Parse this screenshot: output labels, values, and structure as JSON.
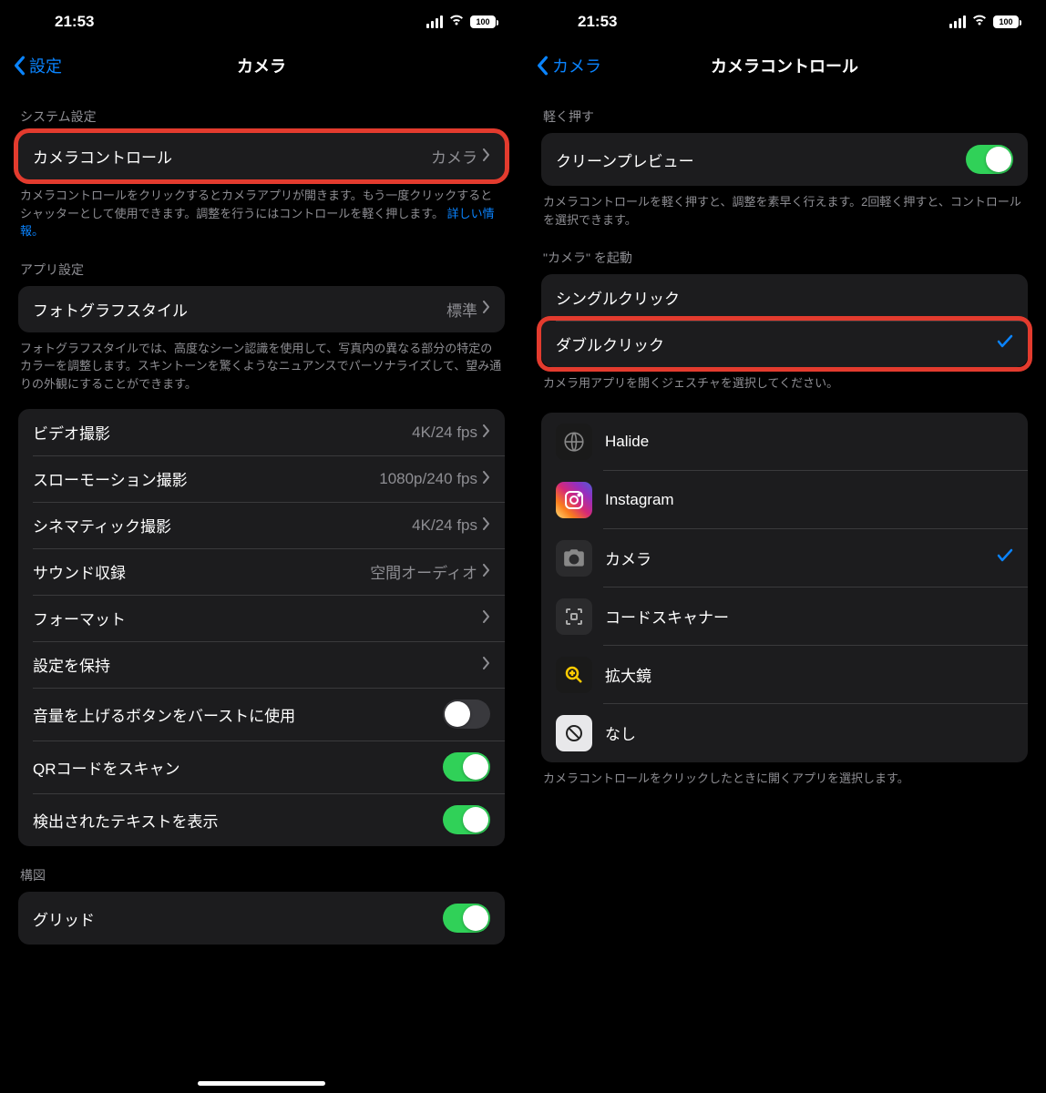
{
  "statusbar": {
    "time": "21:53",
    "battery": "100"
  },
  "left": {
    "back": "設定",
    "title": "カメラ",
    "section_system": "システム設定",
    "camera_control": {
      "label": "カメラコントロール",
      "value": "カメラ"
    },
    "camera_control_footer": "カメラコントロールをクリックするとカメラアプリが開きます。もう一度クリックするとシャッターとして使用できます。調整を行うにはコントロールを軽く押します。",
    "camera_control_footer_link": "詳しい情報。",
    "section_app": "アプリ設定",
    "photo_style": {
      "label": "フォトグラフスタイル",
      "value": "標準"
    },
    "photo_style_footer": "フォトグラフスタイルでは、高度なシーン認識を使用して、写真内の異なる部分の特定のカラーを調整します。スキントーンを驚くようなニュアンスでパーソナライズして、望み通りの外観にすることができます。",
    "rows": {
      "video": {
        "label": "ビデオ撮影",
        "value": "4K/24 fps"
      },
      "slomo": {
        "label": "スローモーション撮影",
        "value": "1080p/240 fps"
      },
      "cinematic": {
        "label": "シネマティック撮影",
        "value": "4K/24 fps"
      },
      "sound": {
        "label": "サウンド収録",
        "value": "空間オーディオ"
      },
      "format": {
        "label": "フォーマット"
      },
      "preserve": {
        "label": "設定を保持"
      },
      "volume_burst": {
        "label": "音量を上げるボタンをバーストに使用"
      },
      "qr": {
        "label": "QRコードをスキャン"
      },
      "text": {
        "label": "検出されたテキストを表示"
      }
    },
    "section_composition": "構図",
    "grid": {
      "label": "グリッド"
    }
  },
  "right": {
    "back": "カメラ",
    "title": "カメラコントロール",
    "section_light": "軽く押す",
    "clean_preview": {
      "label": "クリーンプレビュー"
    },
    "clean_preview_footer": "カメラコントロールを軽く押すと、調整を素早く行えます。2回軽く押すと、コントロールを選択できます。",
    "section_launch": "\"カメラ\" を起動",
    "single_click": "シングルクリック",
    "double_click": "ダブルクリック",
    "launch_footer": "カメラ用アプリを開くジェスチャを選択してください。",
    "apps": {
      "halide": "Halide",
      "instagram": "Instagram",
      "camera": "カメラ",
      "scanner": "コードスキャナー",
      "magnifier": "拡大鏡",
      "none": "なし"
    },
    "apps_footer": "カメラコントロールをクリックしたときに開くアプリを選択します。"
  }
}
